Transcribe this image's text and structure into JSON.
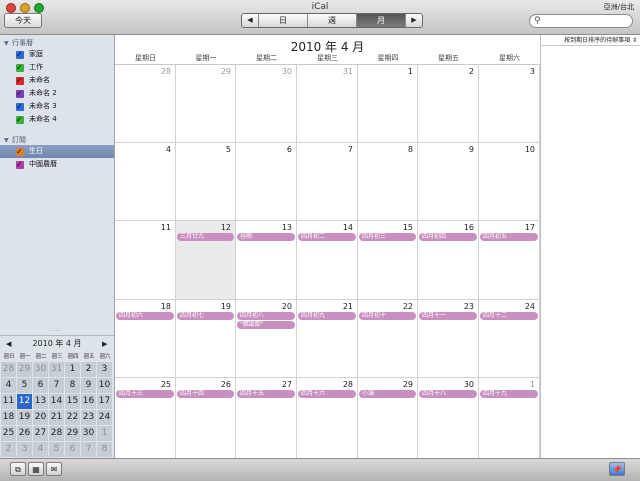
{
  "window": {
    "title": "iCal",
    "region": "亞洲/台北"
  },
  "toolbar": {
    "today_label": "今天",
    "prev_label": "◀",
    "next_label": "▶",
    "views": [
      {
        "label": "日",
        "selected": false
      },
      {
        "label": "週",
        "selected": false
      },
      {
        "label": "月",
        "selected": true
      }
    ],
    "search": {
      "value": "",
      "icon": "search-icon"
    }
  },
  "sidebar": {
    "groups": [
      {
        "title": "行事曆",
        "items": [
          {
            "label": "家庭",
            "color": "#2f6ad8",
            "checked": true,
            "selected": false
          },
          {
            "label": "工作",
            "color": "#39b23a",
            "checked": true,
            "selected": false
          },
          {
            "label": "未命名",
            "color": "#d8262b",
            "checked": true,
            "selected": false
          },
          {
            "label": "未命名 2",
            "color": "#7d3fb8",
            "checked": true,
            "selected": false
          },
          {
            "label": "未命名 3",
            "color": "#2f6ad8",
            "checked": true,
            "selected": false
          },
          {
            "label": "未命名 4",
            "color": "#39b23a",
            "checked": true,
            "selected": false
          }
        ]
      },
      {
        "title": "訂閱",
        "items": [
          {
            "label": "生日",
            "color": "#e0802a",
            "checked": true,
            "selected": true
          },
          {
            "label": "中國農曆",
            "color": "#b23fa8",
            "checked": true,
            "selected": false
          }
        ]
      }
    ],
    "mini_calendar": {
      "title": "2010 年 4 月",
      "weekdays": [
        "週日",
        "週一",
        "週二",
        "週三",
        "週四",
        "週五",
        "週六"
      ],
      "weeks": [
        [
          {
            "d": "28",
            "o": true
          },
          {
            "d": "29",
            "o": true
          },
          {
            "d": "30",
            "o": true
          },
          {
            "d": "31",
            "o": true
          },
          {
            "d": "1"
          },
          {
            "d": "2"
          },
          {
            "d": "3"
          }
        ],
        [
          {
            "d": "4"
          },
          {
            "d": "5"
          },
          {
            "d": "6"
          },
          {
            "d": "7"
          },
          {
            "d": "8"
          },
          {
            "d": "9"
          },
          {
            "d": "10"
          }
        ],
        [
          {
            "d": "11"
          },
          {
            "d": "12",
            "today": true
          },
          {
            "d": "13"
          },
          {
            "d": "14"
          },
          {
            "d": "15"
          },
          {
            "d": "16"
          },
          {
            "d": "17"
          }
        ],
        [
          {
            "d": "18"
          },
          {
            "d": "19"
          },
          {
            "d": "20"
          },
          {
            "d": "21"
          },
          {
            "d": "22"
          },
          {
            "d": "23"
          },
          {
            "d": "24"
          }
        ],
        [
          {
            "d": "25"
          },
          {
            "d": "26"
          },
          {
            "d": "27"
          },
          {
            "d": "28"
          },
          {
            "d": "29"
          },
          {
            "d": "30"
          },
          {
            "d": "1",
            "o": true
          }
        ],
        [
          {
            "d": "2",
            "o": true
          },
          {
            "d": "3",
            "o": true
          },
          {
            "d": "4",
            "o": true
          },
          {
            "d": "5",
            "o": true
          },
          {
            "d": "6",
            "o": true
          },
          {
            "d": "7",
            "o": true
          },
          {
            "d": "8",
            "o": true
          }
        ]
      ]
    }
  },
  "main": {
    "month_title": "2010 年 4 月",
    "weekdays": [
      "星期日",
      "星期一",
      "星期二",
      "星期三",
      "星期四",
      "星期五",
      "星期六"
    ],
    "event_color": "#c98fc0",
    "weeks": [
      [
        {
          "d": "28",
          "o": true,
          "ev": []
        },
        {
          "d": "29",
          "o": true,
          "ev": []
        },
        {
          "d": "30",
          "o": true,
          "ev": []
        },
        {
          "d": "31",
          "o": true,
          "ev": []
        },
        {
          "d": "1",
          "ev": []
        },
        {
          "d": "2",
          "ev": []
        },
        {
          "d": "3",
          "ev": []
        }
      ],
      [
        {
          "d": "4",
          "ev": []
        },
        {
          "d": "5",
          "ev": []
        },
        {
          "d": "6",
          "ev": []
        },
        {
          "d": "7",
          "ev": []
        },
        {
          "d": "8",
          "ev": []
        },
        {
          "d": "9",
          "ev": []
        },
        {
          "d": "10",
          "ev": []
        }
      ],
      [
        {
          "d": "11",
          "ev": []
        },
        {
          "d": "12",
          "today": true,
          "ev": [
            "三月廿九"
          ]
        },
        {
          "d": "13",
          "ev": [
            "谷雨"
          ]
        },
        {
          "d": "14",
          "ev": [
            "四月初二"
          ]
        },
        {
          "d": "15",
          "ev": [
            "四月初三"
          ]
        },
        {
          "d": "16",
          "ev": [
            "四月初四"
          ]
        },
        {
          "d": "17",
          "ev": [
            "四月初五"
          ]
        }
      ],
      [
        {
          "d": "18",
          "ev": [
            "四月初六"
          ]
        },
        {
          "d": "19",
          "ev": [
            "四月初七"
          ]
        },
        {
          "d": "20",
          "ev": [
            "四月初八",
            "\"佛誕節\""
          ]
        },
        {
          "d": "21",
          "ev": [
            "四月初九"
          ]
        },
        {
          "d": "22",
          "ev": [
            "四月初十"
          ]
        },
        {
          "d": "23",
          "ev": [
            "四月十一"
          ]
        },
        {
          "d": "24",
          "ev": [
            "四月十二"
          ]
        }
      ],
      [
        {
          "d": "25",
          "ev": [
            "四月十三"
          ]
        },
        {
          "d": "26",
          "ev": [
            "四月十四"
          ]
        },
        {
          "d": "27",
          "ev": [
            "四月十五"
          ]
        },
        {
          "d": "28",
          "ev": [
            "四月十六"
          ]
        },
        {
          "d": "29",
          "ev": [
            "小滿"
          ]
        },
        {
          "d": "30",
          "ev": [
            "四月十八"
          ]
        },
        {
          "d": "1",
          "o": true,
          "ev": [
            "四月十九"
          ]
        }
      ]
    ]
  },
  "todo": {
    "sort_label": "按到期日排序的待辦事項 ⇕"
  },
  "bottombar": {
    "buttons": [
      {
        "name": "add-calendar-button",
        "glyph": "⧉"
      },
      {
        "name": "show-minical-button",
        "glyph": "▦"
      },
      {
        "name": "show-notifications-button",
        "glyph": "✉"
      }
    ],
    "todo_button_glyph": "📌"
  }
}
